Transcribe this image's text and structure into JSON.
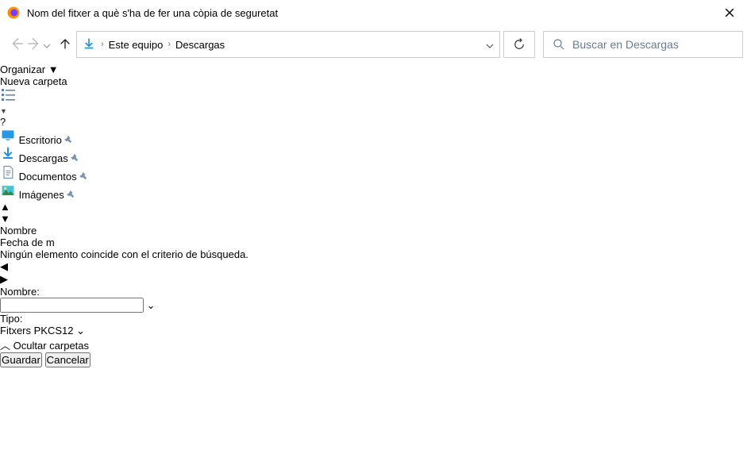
{
  "window": {
    "title": "Nom del fitxer a què s'ha de fer una còpia de seguretat"
  },
  "breadcrumbs": {
    "level1": "Este equipo",
    "level2": "Descargas"
  },
  "search": {
    "placeholder": "Buscar en Descargas"
  },
  "toolbar": {
    "organize": "Organizar",
    "new_folder": "Nueva carpeta"
  },
  "sidebar": {
    "items": [
      {
        "label": "Escritorio",
        "icon": "desktop"
      },
      {
        "label": "Descargas",
        "icon": "download"
      },
      {
        "label": "Documentos",
        "icon": "document"
      },
      {
        "label": "Imágenes",
        "icon": "image"
      }
    ]
  },
  "filelist": {
    "columns": {
      "name": "Nombre",
      "date": "Fecha de m"
    },
    "empty_message": "Ningún elemento coincide con el criterio de búsqueda."
  },
  "form": {
    "name_label_pre": "N",
    "name_label_u": "o",
    "name_label_post": "mbre:",
    "name_value": "",
    "type_label_u": "T",
    "type_label_post": "ipo:",
    "type_value": "Fitxers PKCS12"
  },
  "footer": {
    "hide_folders": "Ocultar carpetas",
    "save_u": "G",
    "save_post": "uardar",
    "cancel": "Cancelar"
  },
  "help_glyph": "?"
}
